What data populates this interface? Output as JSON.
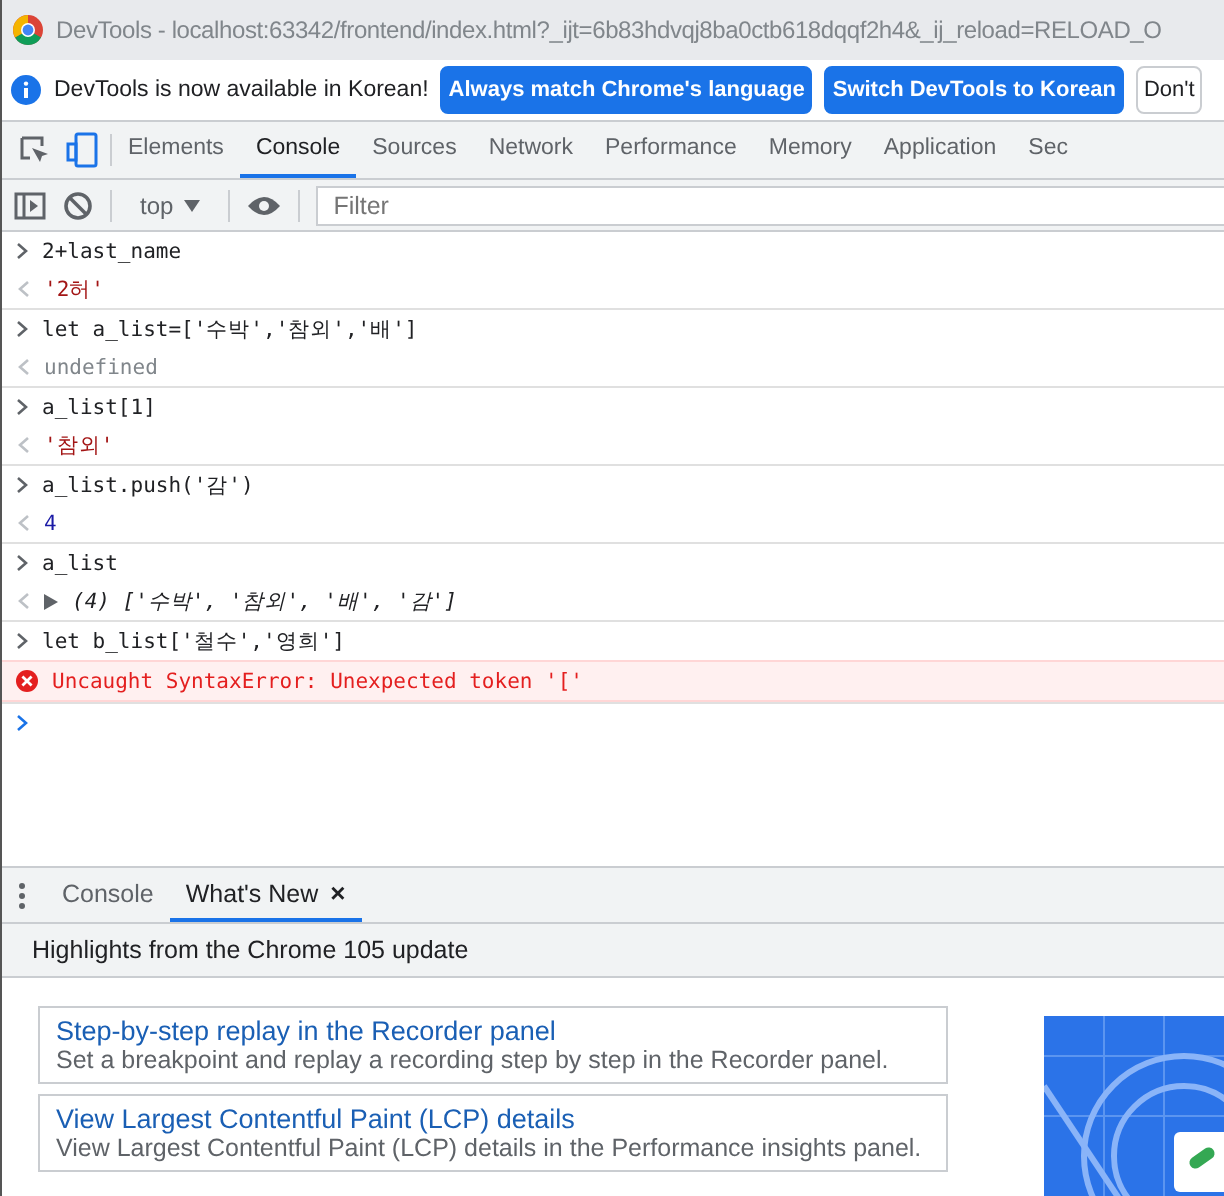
{
  "window": {
    "title": "DevTools - localhost:63342/frontend/index.html?_ijt=6b83hdvqj8ba0ctb618dqqf2h4&_ij_reload=RELOAD_O"
  },
  "infobar": {
    "message": "DevTools is now available in Korean!",
    "buttons": [
      {
        "label": "Always match Chrome's language",
        "kind": "primary"
      },
      {
        "label": "Switch DevTools to Korean",
        "kind": "primary"
      },
      {
        "label": "Don't",
        "kind": "secondary"
      }
    ]
  },
  "tabs": [
    {
      "label": "Elements",
      "selected": false
    },
    {
      "label": "Console",
      "selected": true
    },
    {
      "label": "Sources",
      "selected": false
    },
    {
      "label": "Network",
      "selected": false
    },
    {
      "label": "Performance",
      "selected": false
    },
    {
      "label": "Memory",
      "selected": false
    },
    {
      "label": "Application",
      "selected": false
    },
    {
      "label": "Sec",
      "selected": false
    }
  ],
  "console_toolbar": {
    "context": "top",
    "filter": {
      "placeholder": "Filter"
    }
  },
  "entries": [
    {
      "input": "2+last_name",
      "output": {
        "kind": "string",
        "text": "'2허'"
      }
    },
    {
      "input": "let a_list=['수박','참외','배']",
      "output": {
        "kind": "undefined",
        "text": "undefined"
      }
    },
    {
      "input": "a_list[1]",
      "output": {
        "kind": "string",
        "text": "'참외'"
      }
    },
    {
      "input": "a_list.push('감')",
      "output": {
        "kind": "number",
        "text": "4"
      }
    },
    {
      "input": "a_list",
      "output": {
        "kind": "array",
        "text": "(4) ['수박', '참외', '배', '감']",
        "expanded": false
      }
    },
    {
      "input": "let b_list['철수','영희']",
      "output": {
        "kind": "error",
        "text": "Uncaught SyntaxError: Unexpected token '['"
      }
    }
  ],
  "drawer": {
    "tabs": [
      {
        "label": "Console",
        "selected": false,
        "closable": false
      },
      {
        "label": "What's New",
        "selected": true,
        "closable": true
      }
    ],
    "close_glyph": "×",
    "header": "Highlights from the Chrome 105 update",
    "cards": [
      {
        "title": "Step-by-step replay in the Recorder panel",
        "description": "Set a breakpoint and replay a recording step by step in the Recorder panel."
      },
      {
        "title": "View Largest Contentful Paint (LCP) details",
        "description": "View Largest Contentful Paint (LCP) details in the Performance insights panel."
      }
    ]
  }
}
